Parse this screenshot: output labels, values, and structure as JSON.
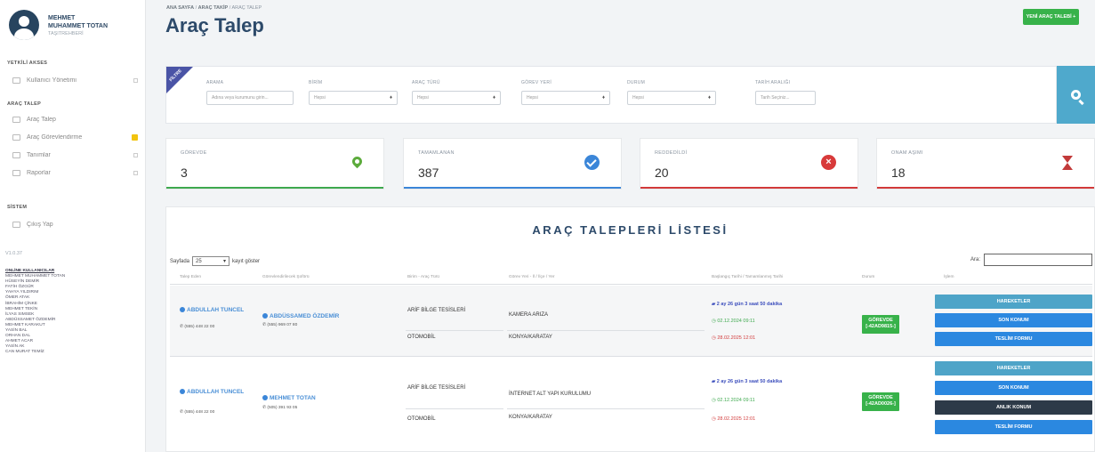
{
  "user": {
    "first_name": "MEHMET",
    "full_name": "MUHAMMET TOTAN",
    "role": "TAŞITREHBERİ"
  },
  "sidebar": {
    "section1_title": "YETKİLİ AKSES",
    "section1_items": [
      {
        "label": "Kullanıcı Yönetimi",
        "icon": "users-icon"
      }
    ],
    "section2_title": "ARAÇ TALEP",
    "section2_items": [
      {
        "label": "Araç Talep",
        "icon": "car-icon"
      },
      {
        "label": "Araç Görevlendirme",
        "icon": "assign-icon"
      },
      {
        "label": "Tanımlar",
        "icon": "list-icon"
      },
      {
        "label": "Raporlar",
        "icon": "report-icon"
      }
    ],
    "section3_title": "SİSTEM",
    "section3_items": [
      {
        "label": "Çıkış Yap",
        "icon": "logout-icon"
      }
    ],
    "version": "V1.0.37",
    "online_title": "ONLİNE KULLANICILAR",
    "online_users": [
      "MEHMET MUHAMMET TOTAN",
      "HÜSEYİN DEMİR",
      "FATİH ÖZGÜR",
      "YAHYA YILDIRIM",
      "ÖMER ATAK",
      "İBRAHİM ÇİNKE",
      "MEHMET TEKİN",
      "İLYAS SIMSEK",
      "ABDÜSSAMET ÖZDEMİR",
      "MEHMET KARAKUT",
      "YASİN BAL",
      "ORHAN DAL",
      "AHMET ACAR",
      "YASİN AK",
      "CAN MURAT TEMİZ"
    ]
  },
  "header": {
    "breadcrumb": [
      "ANA SAYFA",
      "ARAÇ TAKİP",
      "ARAÇ TALEP"
    ],
    "title": "Araç Talep",
    "new_button": "YENİ ARAÇ TALEBİ +"
  },
  "filters": {
    "ribbon": "FİLTRE",
    "fields": [
      {
        "label": "ARAMA",
        "value": "Adına veya kurumunu girin..."
      },
      {
        "label": "BİRİM",
        "value": "Hepsi"
      },
      {
        "label": "ARAÇ TÜRÜ",
        "value": "Hepsi"
      },
      {
        "label": "GÖREV YERİ",
        "value": "Hepsi"
      },
      {
        "label": "DURUM",
        "value": "Hepsi"
      },
      {
        "label": "TARİH ARALIĞI",
        "value": "Tarih Seçiniz..."
      }
    ]
  },
  "stats": [
    {
      "label": "GÖREVDE",
      "value": "3",
      "color": "#3ea94e",
      "icon": "location-pin-icon"
    },
    {
      "label": "TAMAMLANAN",
      "value": "387",
      "color": "#3b86d8",
      "icon": "check-circle-icon"
    },
    {
      "label": "REDDEDİLDİ",
      "value": "20",
      "color": "#d23a3a",
      "icon": "x-circle-icon"
    },
    {
      "label": "ONAM AŞIMI",
      "value": "18",
      "color": "#d23a3a",
      "icon": "hourglass-icon"
    }
  ],
  "list": {
    "title": "ARAÇ TALEPLERİ LİSTESİ",
    "length_prefix": "Sayfada",
    "length_value": "25",
    "length_suffix": "kayıt göster",
    "search_label": "Ara:",
    "columns": [
      "Talep Eden",
      "Görevlendirilecek Şoförü",
      "Birim - Araç Türü",
      "Görev Yeri - İl / İlçe / Yer",
      "Başlangıç Tarihi / Tamamlanmış Tarihi",
      "Durum",
      "İşlem"
    ],
    "rows": [
      {
        "requester": "ABDULLAH TUNCEL",
        "requester_phone": "(555) 448 22 00",
        "driver": "ABDÜSSAMED ÖZDEMİR",
        "driver_phone": "(555) 969 07 80",
        "unit": "ARİF BİLGE TESİSLERİ",
        "vehicle": "OTOMOBİL",
        "task": "KAMERA ARIZA",
        "location": "KONYA/KARATAY",
        "duration": "2 ay 26 gün 3 saat 50 dakika",
        "start_date": "02.12.2024 09:11",
        "end_date": "28.02.2025 12:01",
        "status_line1": "GÖREVDE",
        "status_line2": "[-42AD9815-]",
        "actions": [
          {
            "label": "HAREKETLER",
            "style": "teal"
          },
          {
            "label": "SON KONUM",
            "style": "blue"
          },
          {
            "label": "TESLİM FORMU",
            "style": "blue"
          }
        ]
      },
      {
        "requester": "ABDULLAH TUNCEL",
        "requester_phone": "(555) 448 22 00",
        "driver": "MEHMET TOTAN",
        "driver_phone": "(505) 391 93 05",
        "unit": "ARİF BİLGE TESİSLERİ",
        "vehicle": "OTOMOBİL",
        "task": "İNTERNET ALT YAPI KURULUMU",
        "location": "KONYA/KARATAY",
        "duration": "2 ay 26 gün 3 saat 50 dakika",
        "start_date": "02.12.2024 09:11",
        "end_date": "28.02.2025 12:01",
        "status_line1": "GÖREVDE",
        "status_line2": "[-42AD0026-]",
        "actions": [
          {
            "label": "HAREKETLER",
            "style": "teal"
          },
          {
            "label": "SON KONUM",
            "style": "blue"
          },
          {
            "label": "ANLIK KONUM",
            "style": "dark"
          },
          {
            "label": "TESLİM FORMU",
            "style": "blue"
          }
        ]
      }
    ]
  }
}
